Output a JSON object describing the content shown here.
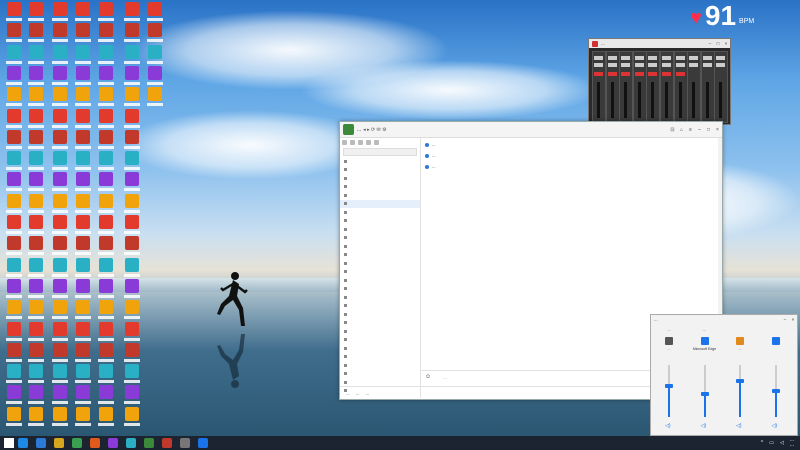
{
  "heart_rate": {
    "value": "91",
    "unit": "BPM",
    "icon": "heart-icon"
  },
  "chat_window": {
    "title": "...",
    "left_panel_items": [
      {
        "label": "",
        "type": "header"
      },
      {
        "label": "",
        "type": "group"
      },
      {
        "label": "",
        "type": "item"
      },
      {
        "label": "",
        "type": "group"
      },
      {
        "label": "",
        "type": "item"
      },
      {
        "label": "",
        "type": "item-selected"
      },
      {
        "label": "",
        "type": "item"
      },
      {
        "label": "",
        "type": "item"
      },
      {
        "label": "",
        "type": "item"
      }
    ],
    "messages": [
      {
        "text": "..."
      },
      {
        "text": "..."
      },
      {
        "text": "..."
      }
    ],
    "input_placeholder": "...",
    "bottom_bar": [
      "...",
      "...",
      "..."
    ]
  },
  "mixer_window": {
    "title": "..."
  },
  "volume_mixer": {
    "title": "...",
    "columns": [
      {
        "header": "...",
        "name": "...",
        "level": 0.6
      },
      {
        "header": "...",
        "name": "Microsoft Edge",
        "level": 0.45
      },
      {
        "header": "",
        "name": "...",
        "level": 0.7
      },
      {
        "header": "",
        "name": "",
        "level": 0.5
      }
    ]
  },
  "taskbar": {
    "time": "...",
    "date": "..."
  },
  "colors": {
    "accent": "#1a73e8",
    "heart": "#ff2d4a",
    "taskbar": "#1b2430"
  }
}
